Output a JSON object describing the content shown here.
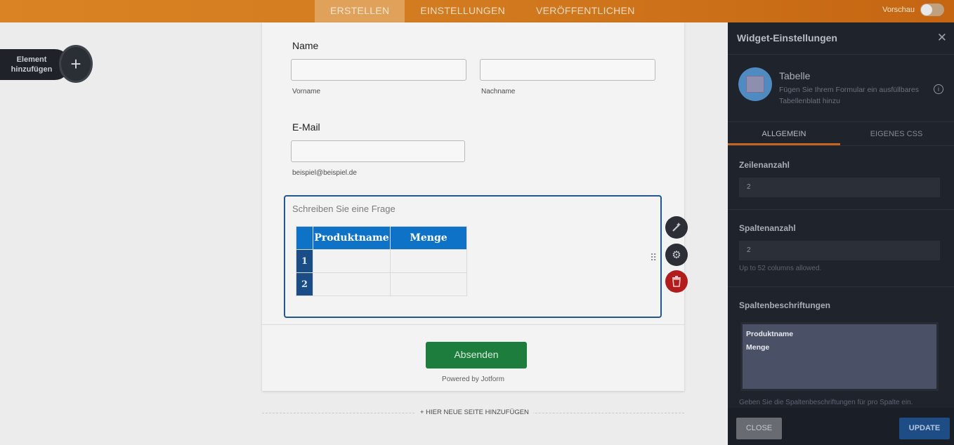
{
  "topbar": {
    "tabs": [
      {
        "label": "ERSTELLEN",
        "active": true
      },
      {
        "label": "EINSTELLUNGEN",
        "active": false
      },
      {
        "label": "VERÖFFENTLICHEN",
        "active": false
      }
    ],
    "preview_label": "Vorschau"
  },
  "add_element": {
    "label_line1": "Element",
    "label_line2": "hinzufügen",
    "icon": "plus-icon"
  },
  "form": {
    "name_label": "Name",
    "first_name_sublabel": "Vorname",
    "last_name_sublabel": "Nachname",
    "email_label": "E-Mail",
    "email_sublabel": "beispiel@beispiel.de",
    "question_placeholder": "Schreiben Sie eine Frage",
    "table": {
      "columns": [
        "Produktname",
        "Menge"
      ],
      "rows": [
        "1",
        "2"
      ]
    },
    "submit_label": "Absenden",
    "powered_by": "Powered by Jotform",
    "add_page_label": "+ HIER NEUE SEITE HINZUFÜGEN"
  },
  "tools": [
    "magic-wand-icon",
    "gear-icon",
    "trash-icon"
  ],
  "panel": {
    "title": "Widget-Einstellungen",
    "widget_name": "Tabelle",
    "widget_description": "Fügen Sie Ihrem Formular ein ausfüllbares Tabellenblatt hinzu",
    "tabs": [
      {
        "label": "ALLGEMEIN",
        "active": true
      },
      {
        "label": "EIGENES CSS",
        "active": false
      }
    ],
    "rows_label": "Zeilenanzahl",
    "rows_value": "2",
    "cols_label": "Spaltenanzahl",
    "cols_value": "2",
    "cols_note": "Up to 52 columns allowed.",
    "col_labels_label": "Spaltenbeschriftungen",
    "col_labels_values": [
      "Produktname",
      "Menge"
    ],
    "col_labels_note": "Geben Sie die Spaltenbeschriftungen für pro Spalte ein.",
    "close_label": "CLOSE",
    "update_label": "UPDATE"
  },
  "colors": {
    "topbar": "#d27a1f",
    "table_header": "#0e73c7",
    "submit": "#1c7d3c",
    "panel_bg": "#1e232c",
    "tab_underline": "#c8641f",
    "update": "#1e4d86",
    "delete": "#b21c1c"
  }
}
